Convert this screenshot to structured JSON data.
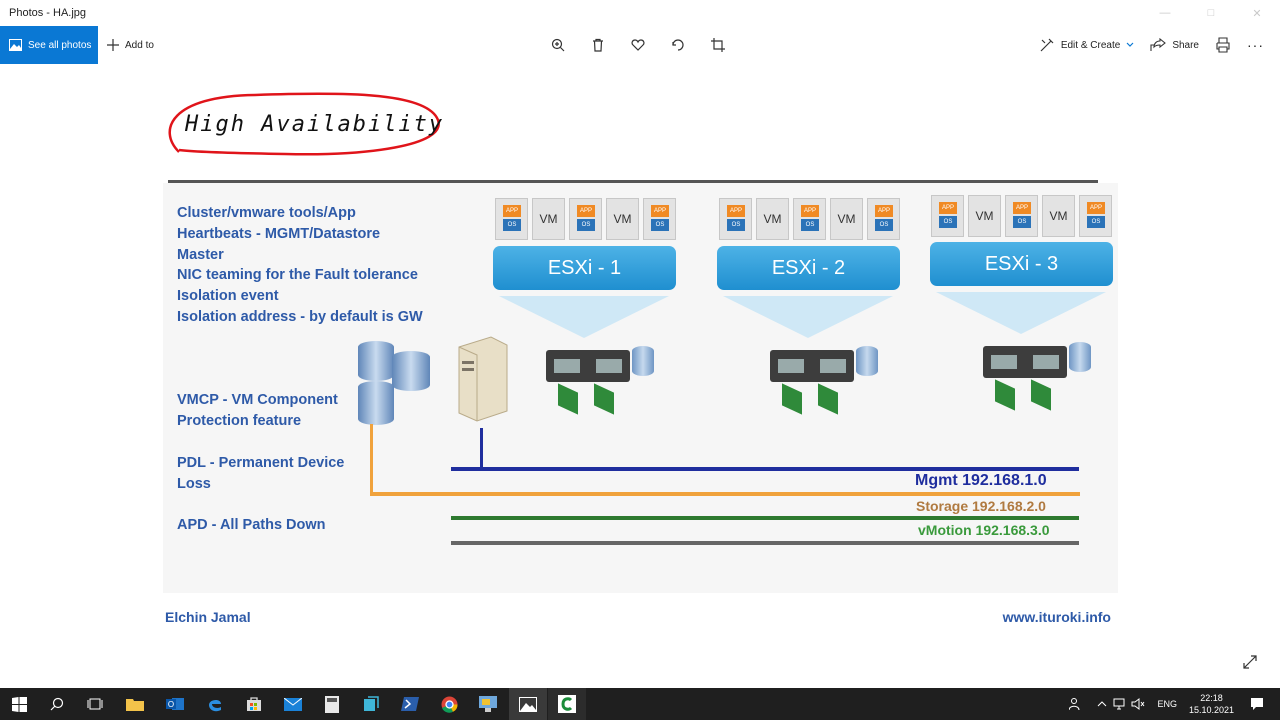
{
  "window": {
    "title": "Photos - HA.jpg"
  },
  "toolbar": {
    "see_all_photos": "See all photos",
    "add_to": "Add to",
    "edit_create": "Edit & Create",
    "share": "Share",
    "more": "···"
  },
  "slide": {
    "title": "High Availability",
    "bullets": [
      "Cluster/vmware tools/App",
      "Heartbeats - MGMT/Datastore",
      "Master",
      "NIC teaming for the Fault tolerance",
      "Isolation event",
      "Isolation address - by default is GW"
    ],
    "vmcp": [
      "VMCP - VM Component",
      "Protection feature"
    ],
    "pdl": [
      "PDL - Permanent Device",
      "Loss"
    ],
    "apd": "APD - All Paths Down",
    "hosts": [
      {
        "name": "ESXi - 1",
        "vms": [
          "app",
          "VM",
          "app",
          "VM",
          "app"
        ]
      },
      {
        "name": "ESXi - 2",
        "vms": [
          "app",
          "VM",
          "app",
          "VM",
          "app"
        ]
      },
      {
        "name": "ESXi - 3",
        "vms": [
          "app",
          "VM",
          "app",
          "VM",
          "app"
        ]
      }
    ],
    "vm_app_top": "APP",
    "vm_app_bottom": "OS",
    "networks": {
      "mgmt": "Mgmt 192.168.1.0",
      "storage": "Storage 192.168.2.0",
      "vmotion": "vMotion 192.168.3.0"
    },
    "colors": {
      "mgmt": "#1f2e9e",
      "storage": "#f0a23c",
      "vmotion": "#2e7a30",
      "other": "#666666",
      "text": "#2e5aa8"
    },
    "author": "Elchin Jamal",
    "website": "www.ituroki.info"
  },
  "taskbar": {
    "lang": "ENG",
    "time": "22:18",
    "date": "15.10.2021"
  }
}
